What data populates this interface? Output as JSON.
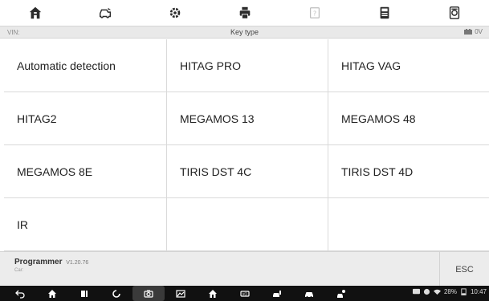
{
  "toolbar": {
    "icons": [
      "home-icon",
      "vehicle-swap-icon",
      "settings-icon",
      "print-icon",
      "help-icon",
      "save-icon",
      "datalogging-icon"
    ]
  },
  "status": {
    "vin_label": "VIN:",
    "title": "Key type",
    "voltage": "0V"
  },
  "grid": {
    "items": [
      "Automatic detection",
      "HITAG PRO",
      "HITAG VAG",
      "HITAG2",
      "MEGAMOS 13",
      "MEGAMOS 48",
      "MEGAMOS 8E",
      "TIRIS DST 4C",
      "TIRIS DST 4D",
      "IR",
      "",
      ""
    ]
  },
  "footer": {
    "app_name": "Programmer",
    "version": "V1.20.76",
    "car_label": "Car:",
    "esc_label": "ESC"
  },
  "system": {
    "battery": "28%",
    "time": "10:47"
  },
  "colors": {
    "toolbar_icon": "#2b2b2b",
    "status_bg": "#e9e9e9",
    "footer_bg": "#ececec",
    "navbar_bg": "#111111"
  }
}
